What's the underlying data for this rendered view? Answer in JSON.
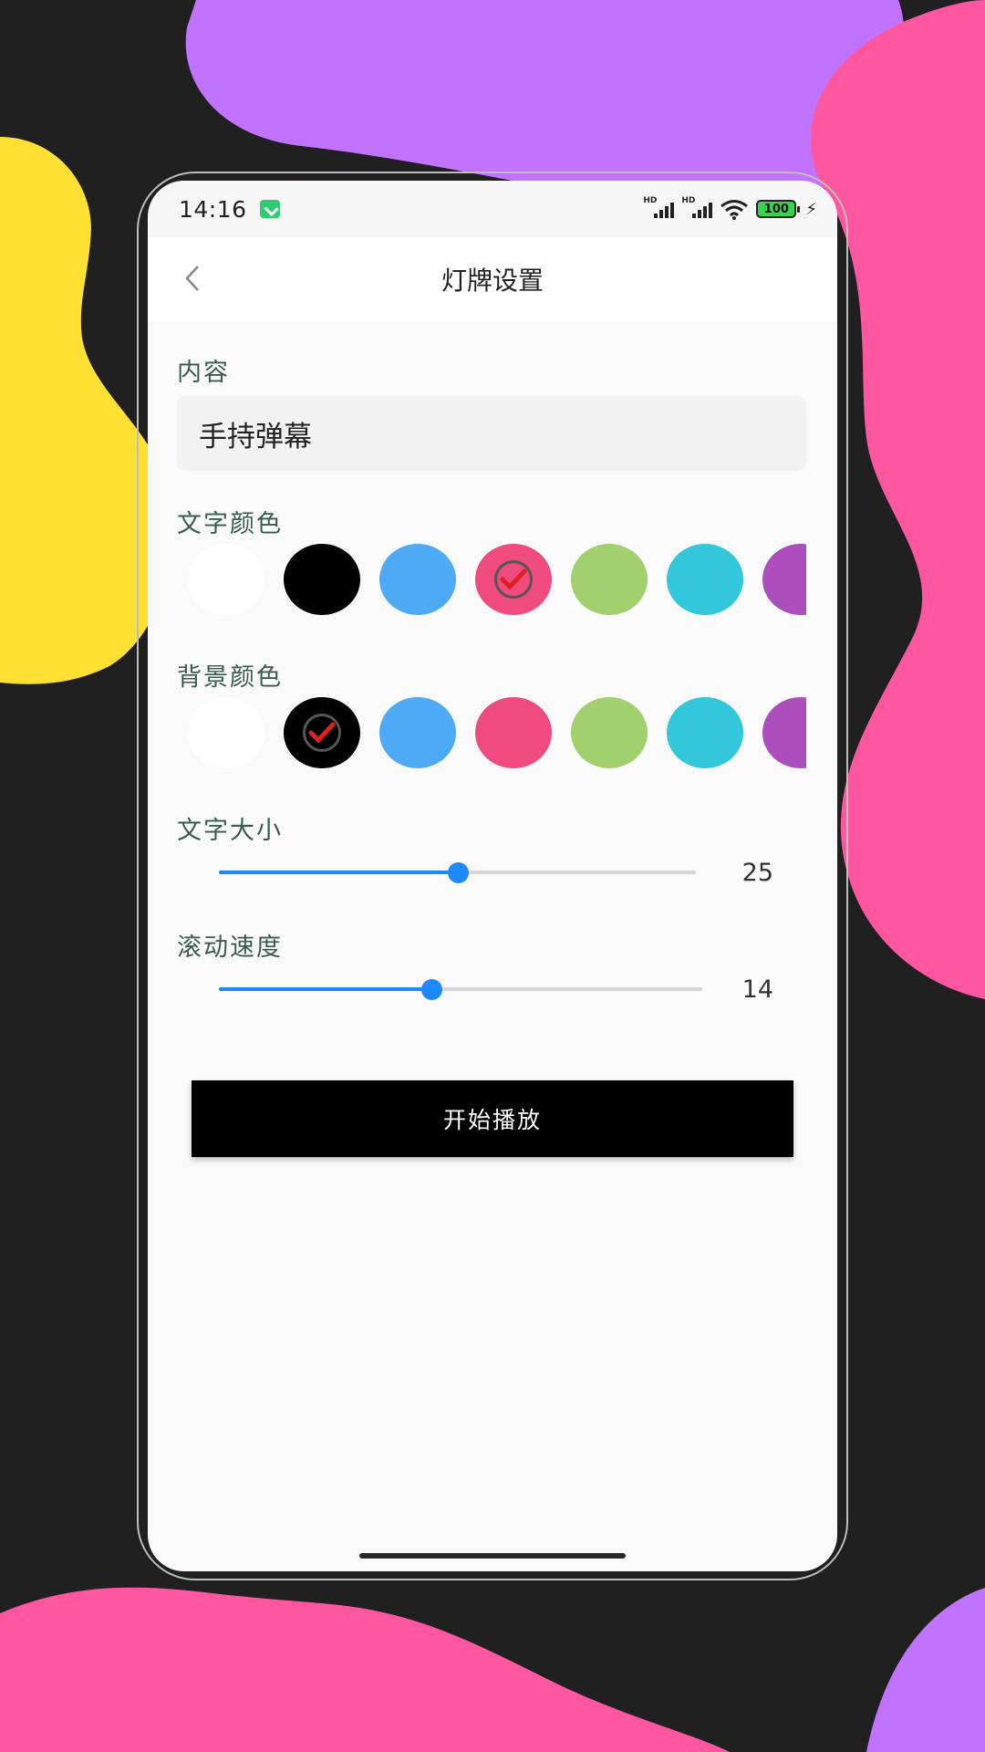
{
  "status_bar": {
    "time": "14:16",
    "signal_1_label": "HD",
    "signal_2_label": "HD",
    "battery_level": "100",
    "icons": [
      "download-icon",
      "signal-icon",
      "signal-icon",
      "wifi-icon",
      "battery-icon",
      "charging-icon"
    ]
  },
  "header": {
    "title": "灯牌设置",
    "back_icon": "chevron-left-icon"
  },
  "content_section": {
    "label": "内容",
    "input_value": "手持弹幕"
  },
  "text_color": {
    "label": "文字颜色",
    "swatches": [
      "#ffffff",
      "#000000",
      "#4eaaf5",
      "#ef4b7f",
      "#a2d06e",
      "#33c7db",
      "#ab4fbd"
    ],
    "selected_index": 3
  },
  "bg_color": {
    "label": "背景颜色",
    "swatches": [
      "#ffffff",
      "#000000",
      "#4eaaf5",
      "#ef4b7f",
      "#a2d06e",
      "#33c7db",
      "#ab4fbd"
    ],
    "selected_index": 1
  },
  "text_size": {
    "label": "文字大小",
    "value": "25",
    "fraction": 0.5
  },
  "scroll_speed": {
    "label": "滚动速度",
    "value": "14",
    "fraction": 0.44
  },
  "play_button": {
    "label": "开始播放"
  },
  "colors": {
    "background": "#202020",
    "blob_purple": "#c172ff",
    "blob_pink": "#ff56a0",
    "blob_yellow": "#ffe033",
    "accent_blue": "#1e88ff",
    "check_red": "#e02020"
  }
}
